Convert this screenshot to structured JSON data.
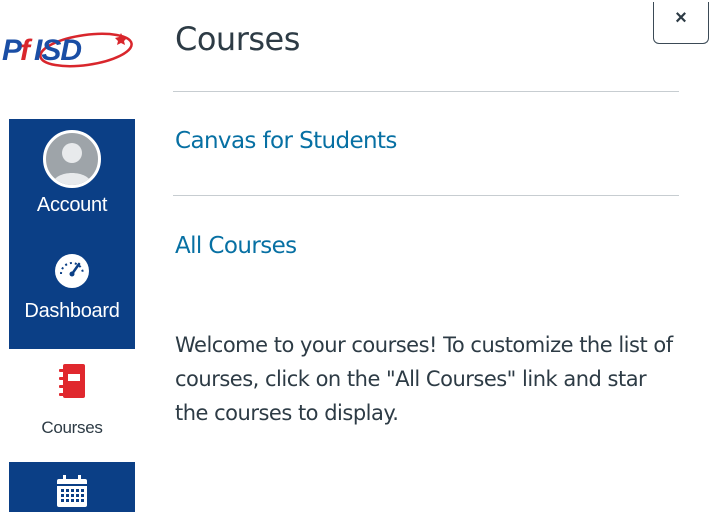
{
  "logo": {
    "text": "PfISD"
  },
  "global_nav": {
    "items": [
      {
        "label": "Account",
        "icon": "user-avatar-icon",
        "active": true
      },
      {
        "label": "Dashboard",
        "icon": "speedometer-icon",
        "active": true
      },
      {
        "label": "Courses",
        "icon": "notebook-icon",
        "active": false
      },
      {
        "label": "",
        "icon": "calendar-icon",
        "active": true
      }
    ]
  },
  "tray": {
    "title": "Courses",
    "close_label": "×",
    "links": [
      {
        "label": "Canvas for Students"
      },
      {
        "label": "All Courses"
      }
    ],
    "message": "Welcome to your courses! To customize the list of courses, click on the \"All Courses\" link and star the courses to display."
  },
  "colors": {
    "nav_background": "#0b3f86",
    "link": "#0770a3",
    "text": "#2d3b45",
    "courses_icon": "#e0282e",
    "logo_blue": "#1a4ea5",
    "logo_red": "#d9262c"
  }
}
